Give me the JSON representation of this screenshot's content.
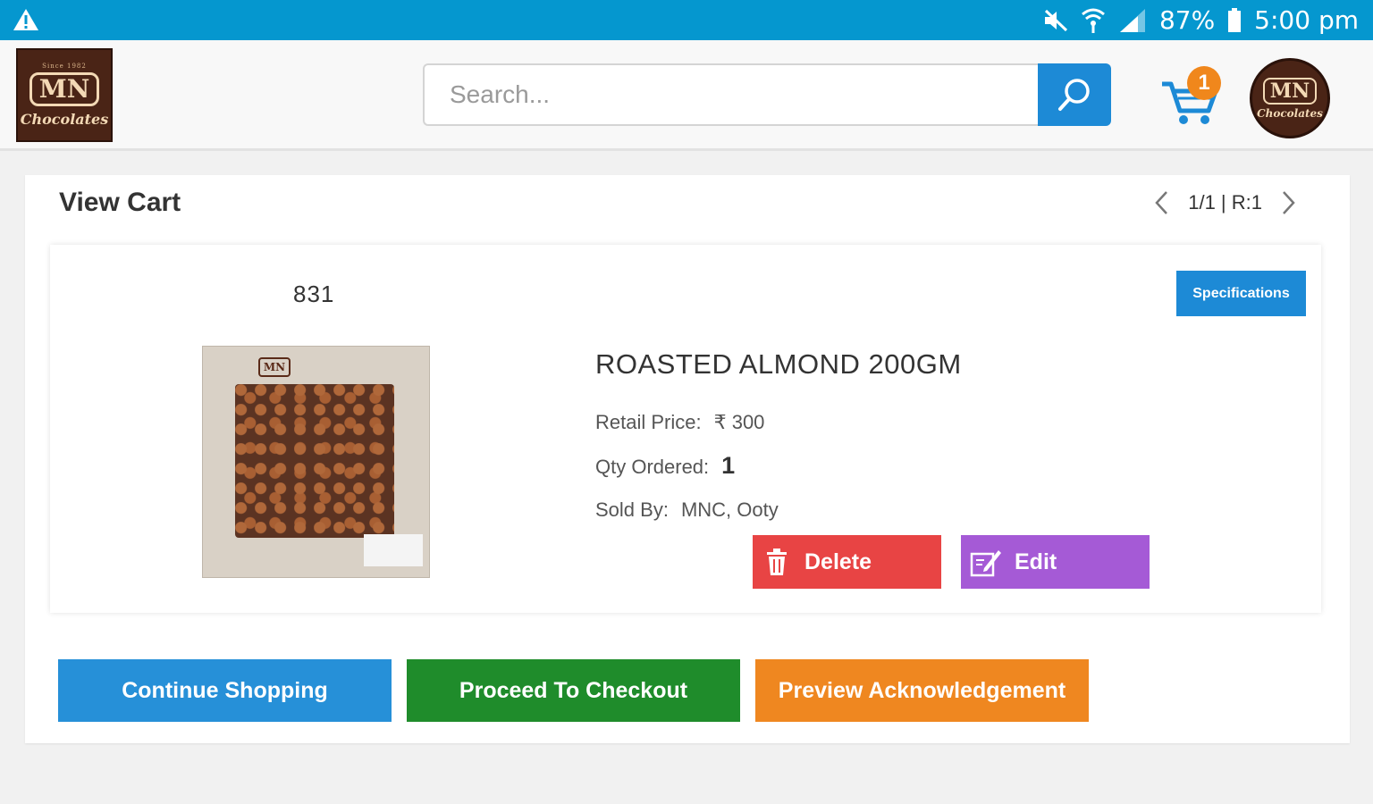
{
  "status_bar": {
    "battery": "87%",
    "time": "5:00 pm",
    "icons": [
      "warning-icon",
      "mute-icon",
      "wifi-icon",
      "signal-icon",
      "battery-icon"
    ]
  },
  "header": {
    "logo": {
      "since": "Since 1982",
      "mark": "MN",
      "name": "Chocolates"
    },
    "search": {
      "placeholder": "Search..."
    },
    "cart": {
      "count": "1"
    },
    "avatar": {
      "mark": "MN",
      "name": "Chocolates"
    }
  },
  "view_cart": {
    "title": "View Cart",
    "pager": {
      "label": "1/1 | R:1"
    }
  },
  "cart_item": {
    "code": "831",
    "specifications_label": "Specifications",
    "name": "ROASTED ALMOND 200GM",
    "retail_price_label": "Retail Price:",
    "retail_price_value": "₹ 300",
    "qty_label": "Qty Ordered:",
    "qty_value": "1",
    "sold_by_label": "Sold By:",
    "sold_by_value": "MNC, Ooty",
    "delete_label": "Delete",
    "edit_label": "Edit"
  },
  "actions": {
    "continue_label": "Continue Shopping",
    "checkout_label": "Proceed To Checkout",
    "preview_label": "Preview Acknowledgement"
  },
  "colors": {
    "status_bar": "#0597cf",
    "primary_blue": "#1d8ad6",
    "cart_badge": "#f0871c",
    "delete": "#e84444",
    "edit": "#a55ad6",
    "continue": "#2690d8",
    "checkout": "#1f8c2b",
    "preview": "#ef8720"
  }
}
